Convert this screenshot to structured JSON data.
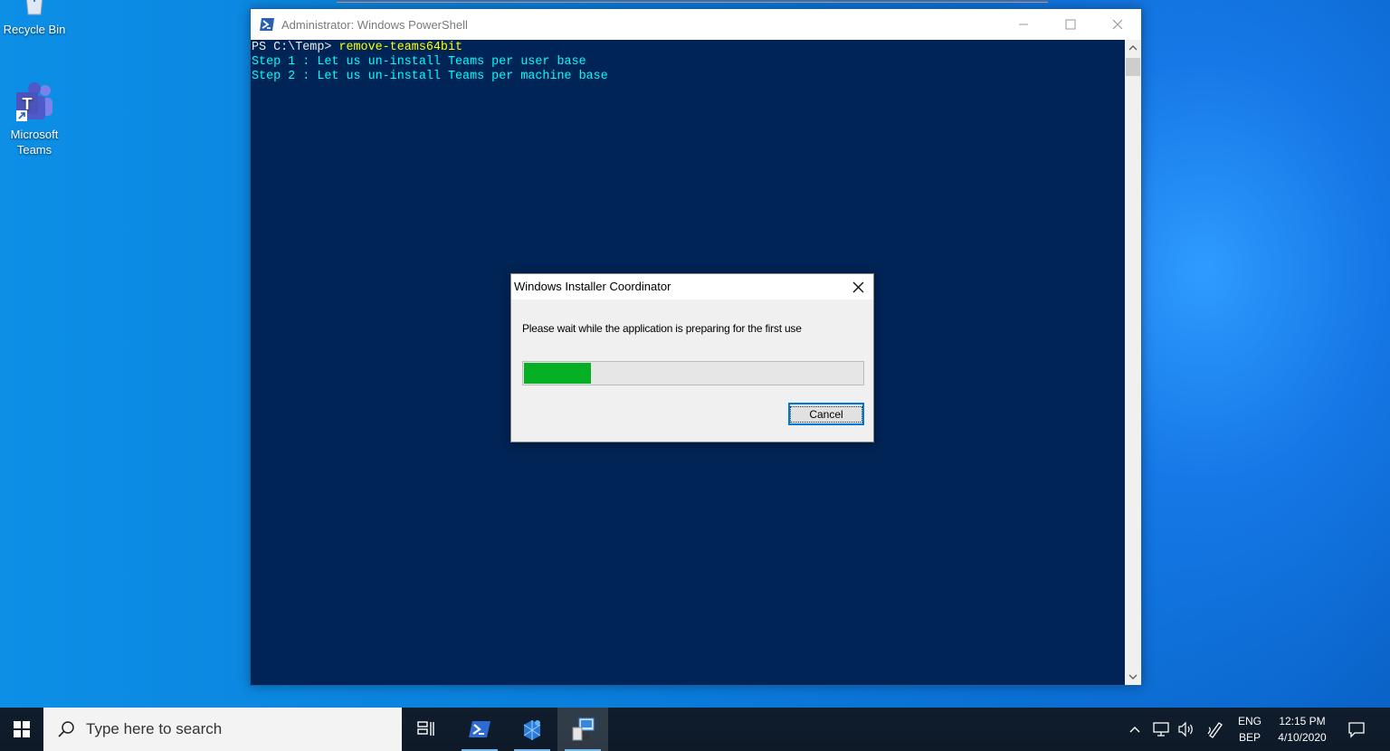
{
  "desktop": {
    "icons": [
      {
        "label": "Recycle Bin",
        "icon": "recycle-bin-icon"
      },
      {
        "label": "Microsoft Teams",
        "icon": "teams-icon"
      }
    ]
  },
  "powershell": {
    "title": "Administrator: Windows PowerShell",
    "icon": "powershell-icon",
    "background_color": "#012456",
    "prompt": "PS C:\\Temp> ",
    "command": "remove-teams64bit",
    "output_lines": [
      "Step 1 : Let us un-install Teams per user base",
      "Step 2 : Let us un-install Teams per machine base"
    ]
  },
  "dialog": {
    "title": "Windows Installer Coordinator",
    "message": "Please wait while the application is preparing for the first use",
    "progress_fraction": 0.2,
    "progress_color": "#06b025",
    "cancel_label": "Cancel"
  },
  "taskbar": {
    "search_placeholder": "Type here to search",
    "apps": [
      "task-view-icon",
      "powershell-icon",
      "windows-installer-icon",
      "installer-coordinator-icon"
    ],
    "language": "ENG",
    "keyboard_layout": "BEP",
    "time": "12:15 PM",
    "date": "4/10/2020",
    "accent": "#76b9ed"
  }
}
